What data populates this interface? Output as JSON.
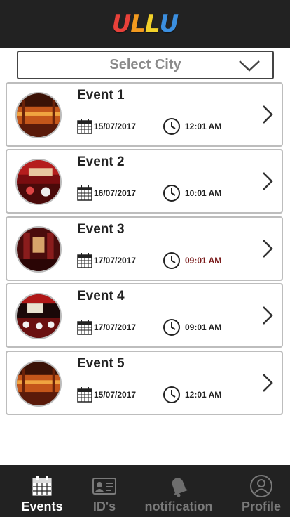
{
  "header": {
    "logo_letters": [
      "U",
      "L",
      "L",
      "U"
    ],
    "logo_colors": [
      "#e8413a",
      "#f39a1f",
      "#f2d12a",
      "#3b8fe0"
    ]
  },
  "city_select": {
    "label": "Select City"
  },
  "events": [
    {
      "title": "Event 1",
      "date": "15/07/2017",
      "time": "12:01 AM",
      "time_color": "default"
    },
    {
      "title": "Event 2",
      "date": "16/07/2017",
      "time": "10:01 AM",
      "time_color": "default"
    },
    {
      "title": "Event 3",
      "date": "17/07/2017",
      "time": "09:01 AM",
      "time_color": "dark-red"
    },
    {
      "title": "Event 4",
      "date": "17/07/2017",
      "time": "09:01 AM",
      "time_color": "default"
    },
    {
      "title": "Event 5",
      "date": "15/07/2017",
      "time": "12:01 AM",
      "time_color": "default"
    }
  ],
  "bottom_nav": {
    "items": [
      {
        "label": "Events",
        "icon": "calendar-icon",
        "active": true
      },
      {
        "label": "ID's",
        "icon": "id-card-icon",
        "active": false
      },
      {
        "label": "notification",
        "icon": "bell-icon",
        "active": false
      },
      {
        "label": "Profile",
        "icon": "user-icon",
        "active": false
      }
    ]
  },
  "colors": {
    "header_bg": "#222222",
    "nav_bg": "#222222",
    "active_label": "#ffffff",
    "inactive_label": "#7a7a7a"
  }
}
